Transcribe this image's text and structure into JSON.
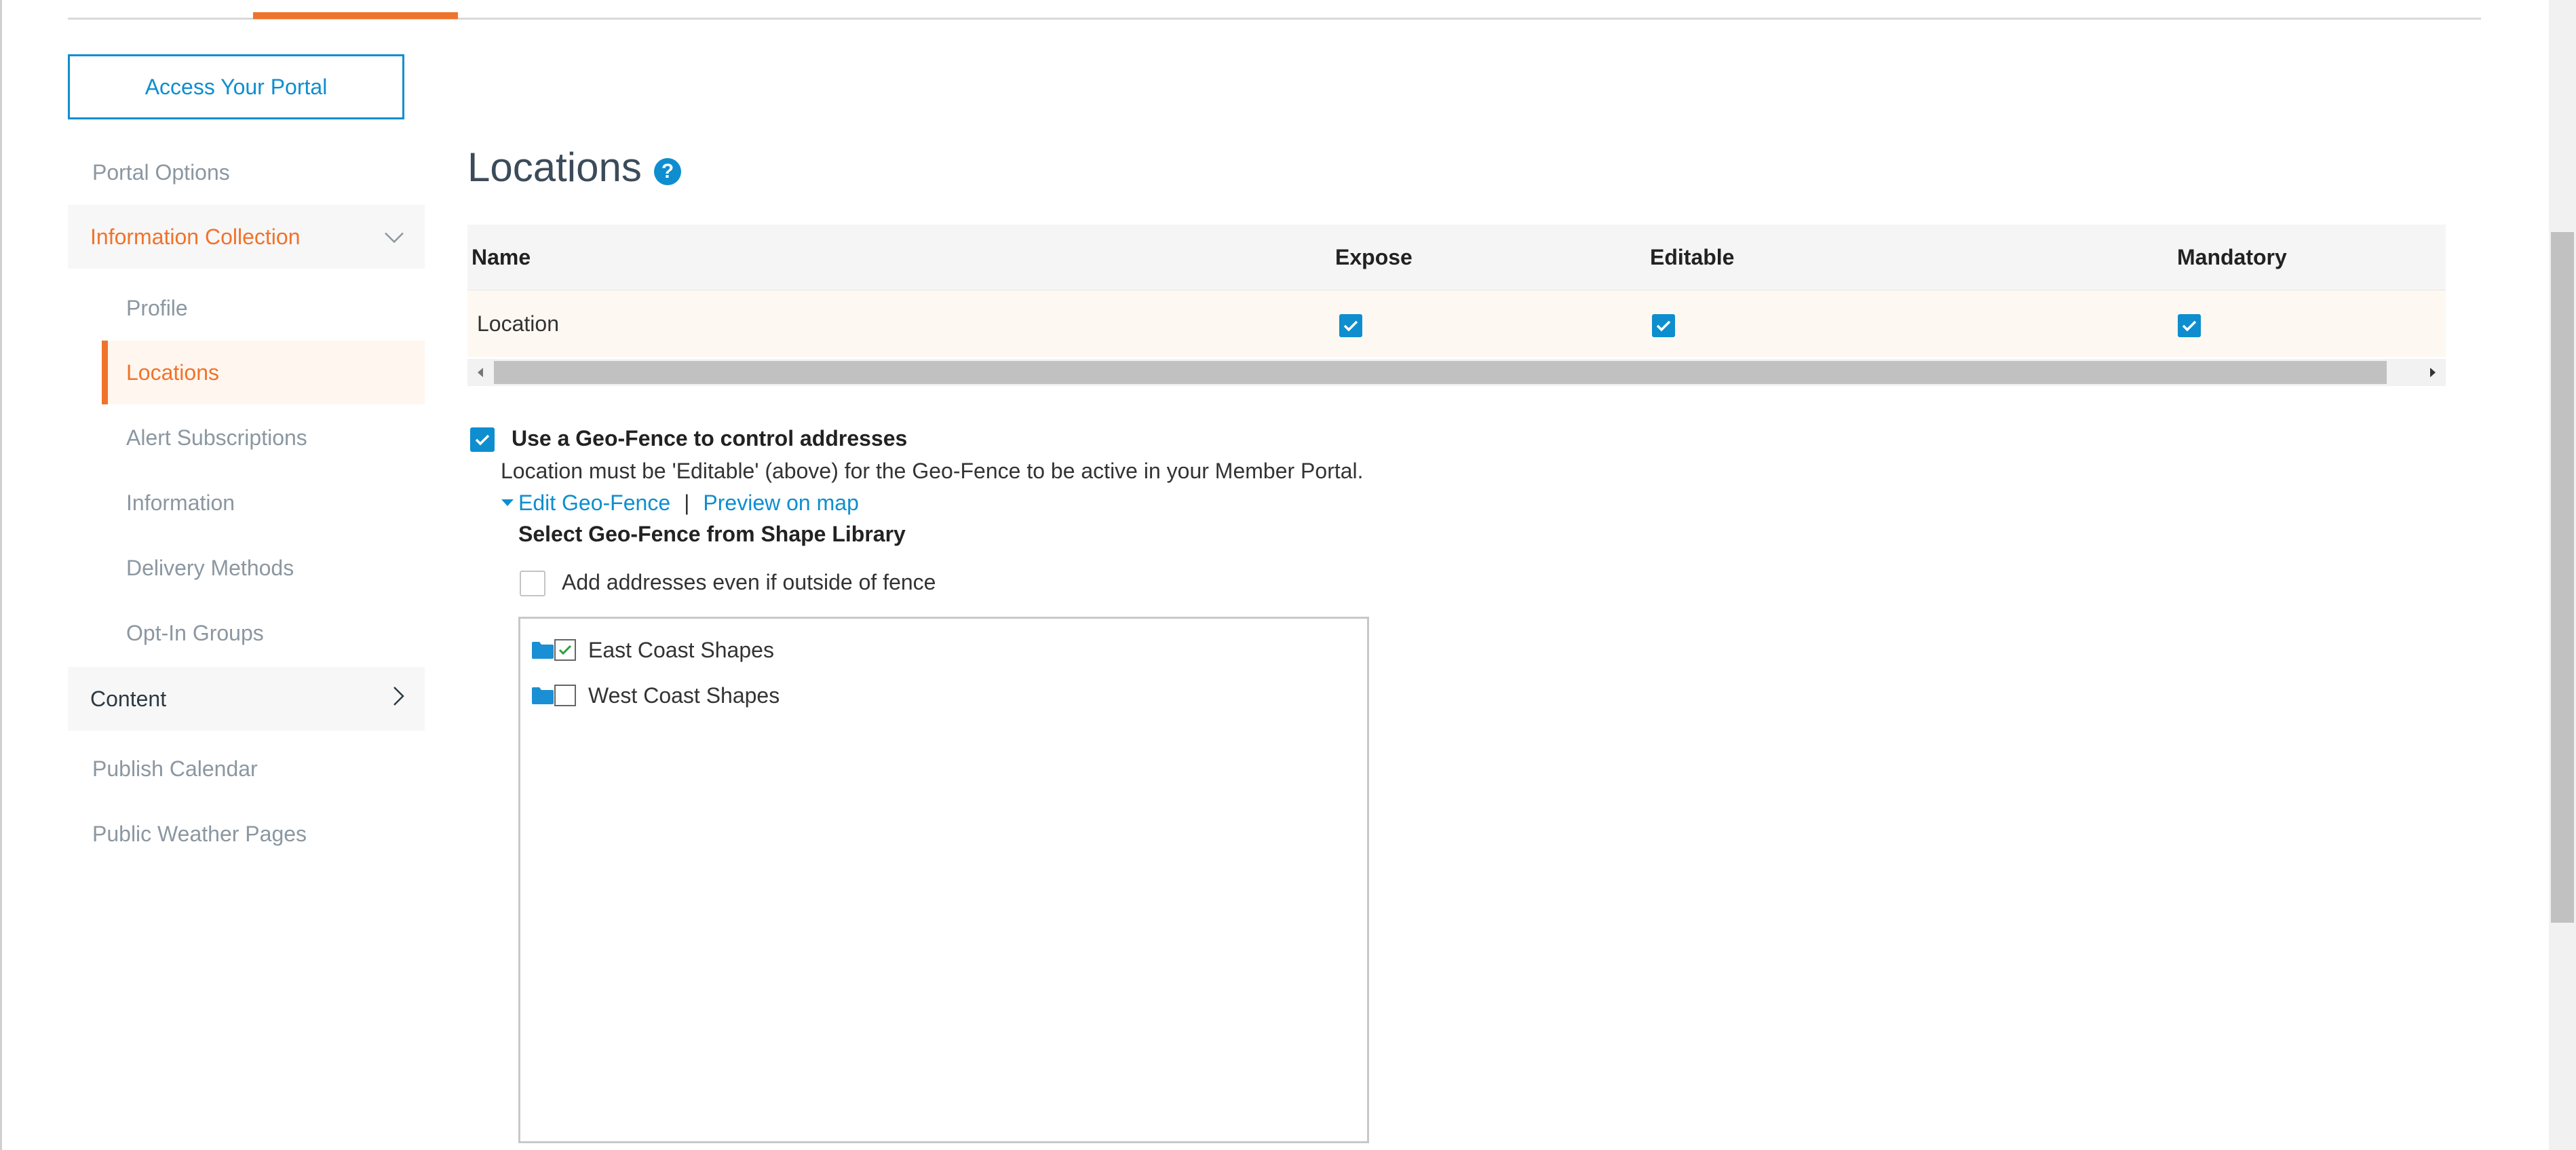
{
  "header": {
    "access_button": "Access Your Portal"
  },
  "sidebar": {
    "items": [
      {
        "label": "Portal Options"
      },
      {
        "label": "Information Collection"
      },
      {
        "label": "Profile"
      },
      {
        "label": "Locations"
      },
      {
        "label": "Alert Subscriptions"
      },
      {
        "label": "Information"
      },
      {
        "label": "Delivery Methods"
      },
      {
        "label": "Opt-In Groups"
      },
      {
        "label": "Content"
      },
      {
        "label": "Publish Calendar"
      },
      {
        "label": "Public Weather Pages"
      }
    ]
  },
  "main": {
    "title": "Locations",
    "help_icon": "?",
    "table": {
      "columns": [
        "Name",
        "Expose",
        "Editable",
        "Mandatory"
      ],
      "rows": [
        {
          "name": "Location",
          "expose": true,
          "editable": true,
          "mandatory": true
        }
      ]
    },
    "geofence": {
      "use_label": "Use a Geo-Fence to control addresses",
      "use_checked": true,
      "note": "Location must be 'Editable' (above) for the Geo-Fence to be active in your Member Portal.",
      "edit_link": "Edit Geo-Fence",
      "separator": "|",
      "preview_link": "Preview on map",
      "select_heading": "Select Geo-Fence from Shape Library",
      "outside_label": "Add addresses even if outside of fence",
      "outside_checked": false,
      "shapes": [
        {
          "label": "East Coast Shapes",
          "checked": true
        },
        {
          "label": "West Coast Shapes",
          "checked": false
        }
      ]
    }
  },
  "colors": {
    "accent_orange": "#f0732c",
    "accent_blue": "#0e8ecf",
    "check_green": "#2e9e3b"
  },
  "icons": [
    "help-icon",
    "chevron-down-icon",
    "chevron-right-icon",
    "folder-icon",
    "check-icon",
    "arrow-left-icon",
    "arrow-right-icon",
    "caret-down-icon"
  ]
}
